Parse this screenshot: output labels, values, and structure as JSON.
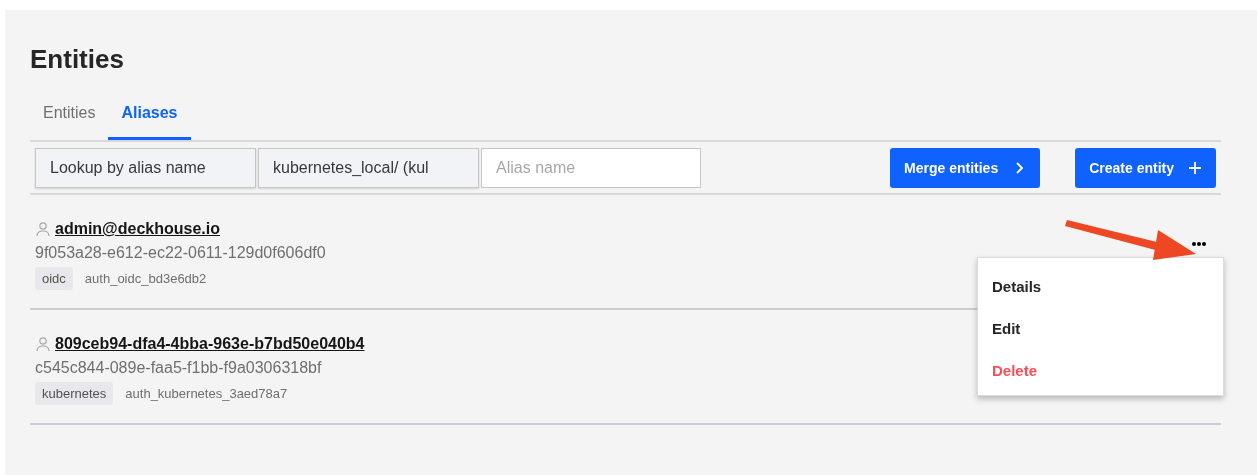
{
  "page": {
    "title": "Entities"
  },
  "tabs": [
    {
      "label": "Entities",
      "selected": false
    },
    {
      "label": "Aliases",
      "selected": true
    }
  ],
  "filters": {
    "lookup": "Lookup by alias name",
    "mount": "kubernetes_local/ (kul",
    "alias": {
      "placeholder": "Alias name"
    }
  },
  "buttons": [
    {
      "label": "Merge entities",
      "kind": "next"
    },
    {
      "label": "Create entity",
      "kind": "add"
    }
  ],
  "entities": [
    {
      "name": "admin@deckhouse.io",
      "id": "9f053a28-e612-ec22-0611-129d0f606df0",
      "tag": "oidc",
      "alias": "auth_oidc_bd3e6db2",
      "menu": {
        "items": [
          {
            "label": "Details",
            "kind": "normal"
          },
          {
            "label": "Edit",
            "kind": "normal"
          },
          {
            "label": "Delete",
            "kind": "danger"
          }
        ]
      }
    },
    {
      "name": "809ceb94-dfa4-4bba-963e-b7bd50e040b4",
      "id": "c545c844-089e-faa5-f1bb-f9a0306318bf",
      "tag": "kubernetes",
      "alias": "auth_kubernetes_3aed78a7"
    }
  ]
}
